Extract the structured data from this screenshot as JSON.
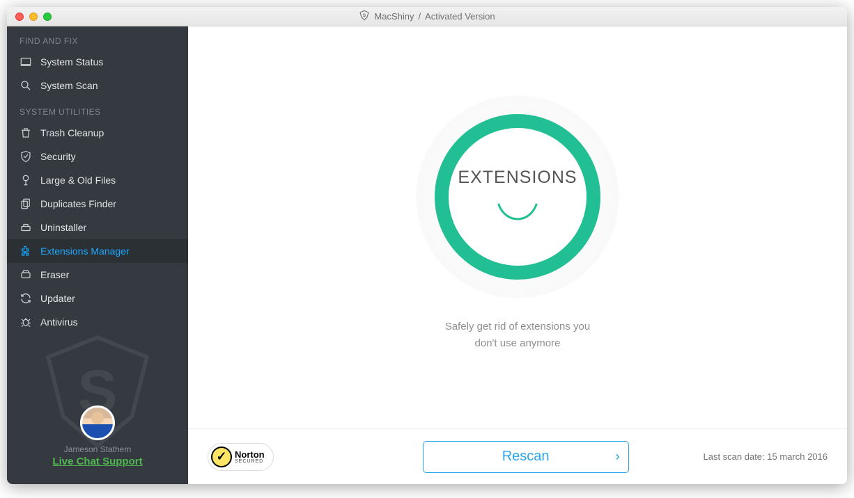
{
  "titlebar": {
    "app_name": "MacShiny",
    "separator": "/",
    "status": "Activated Version"
  },
  "sidebar": {
    "sections": [
      {
        "title": "FIND AND FIX"
      },
      {
        "title": "SYSTEM UTILITIES"
      }
    ],
    "items_findfix": [
      {
        "label": "System Status",
        "icon": "laptop-icon"
      },
      {
        "label": "System Scan",
        "icon": "search-icon"
      }
    ],
    "items_utils": [
      {
        "label": "Trash Cleanup",
        "icon": "trash-icon"
      },
      {
        "label": "Security",
        "icon": "shield-icon"
      },
      {
        "label": "Large & Old Files",
        "icon": "tree-icon"
      },
      {
        "label": "Duplicates Finder",
        "icon": "copy-icon"
      },
      {
        "label": "Uninstaller",
        "icon": "uninstall-icon"
      },
      {
        "label": "Extensions Manager",
        "icon": "puzzle-icon",
        "active": true
      },
      {
        "label": "Eraser",
        "icon": "eraser-icon"
      },
      {
        "label": "Updater",
        "icon": "refresh-icon"
      },
      {
        "label": "Antivirus",
        "icon": "bug-icon"
      }
    ],
    "user_name": "Jameson Stathem",
    "live_chat": "Live Chat Support"
  },
  "main": {
    "circle_title": "EXTENSIONS",
    "tagline_l1": "Safely get rid of extensions you",
    "tagline_l2": "don't use anymore"
  },
  "footer": {
    "norton_line1": "Norton",
    "norton_line2": "SECURED",
    "rescan": "Rescan",
    "last_scan_label": "Last scan date: 15 march 2016"
  },
  "colors": {
    "accent_blue": "#1aa8ff",
    "ring_green": "#23bf94",
    "chat_green": "#4fb54f"
  }
}
